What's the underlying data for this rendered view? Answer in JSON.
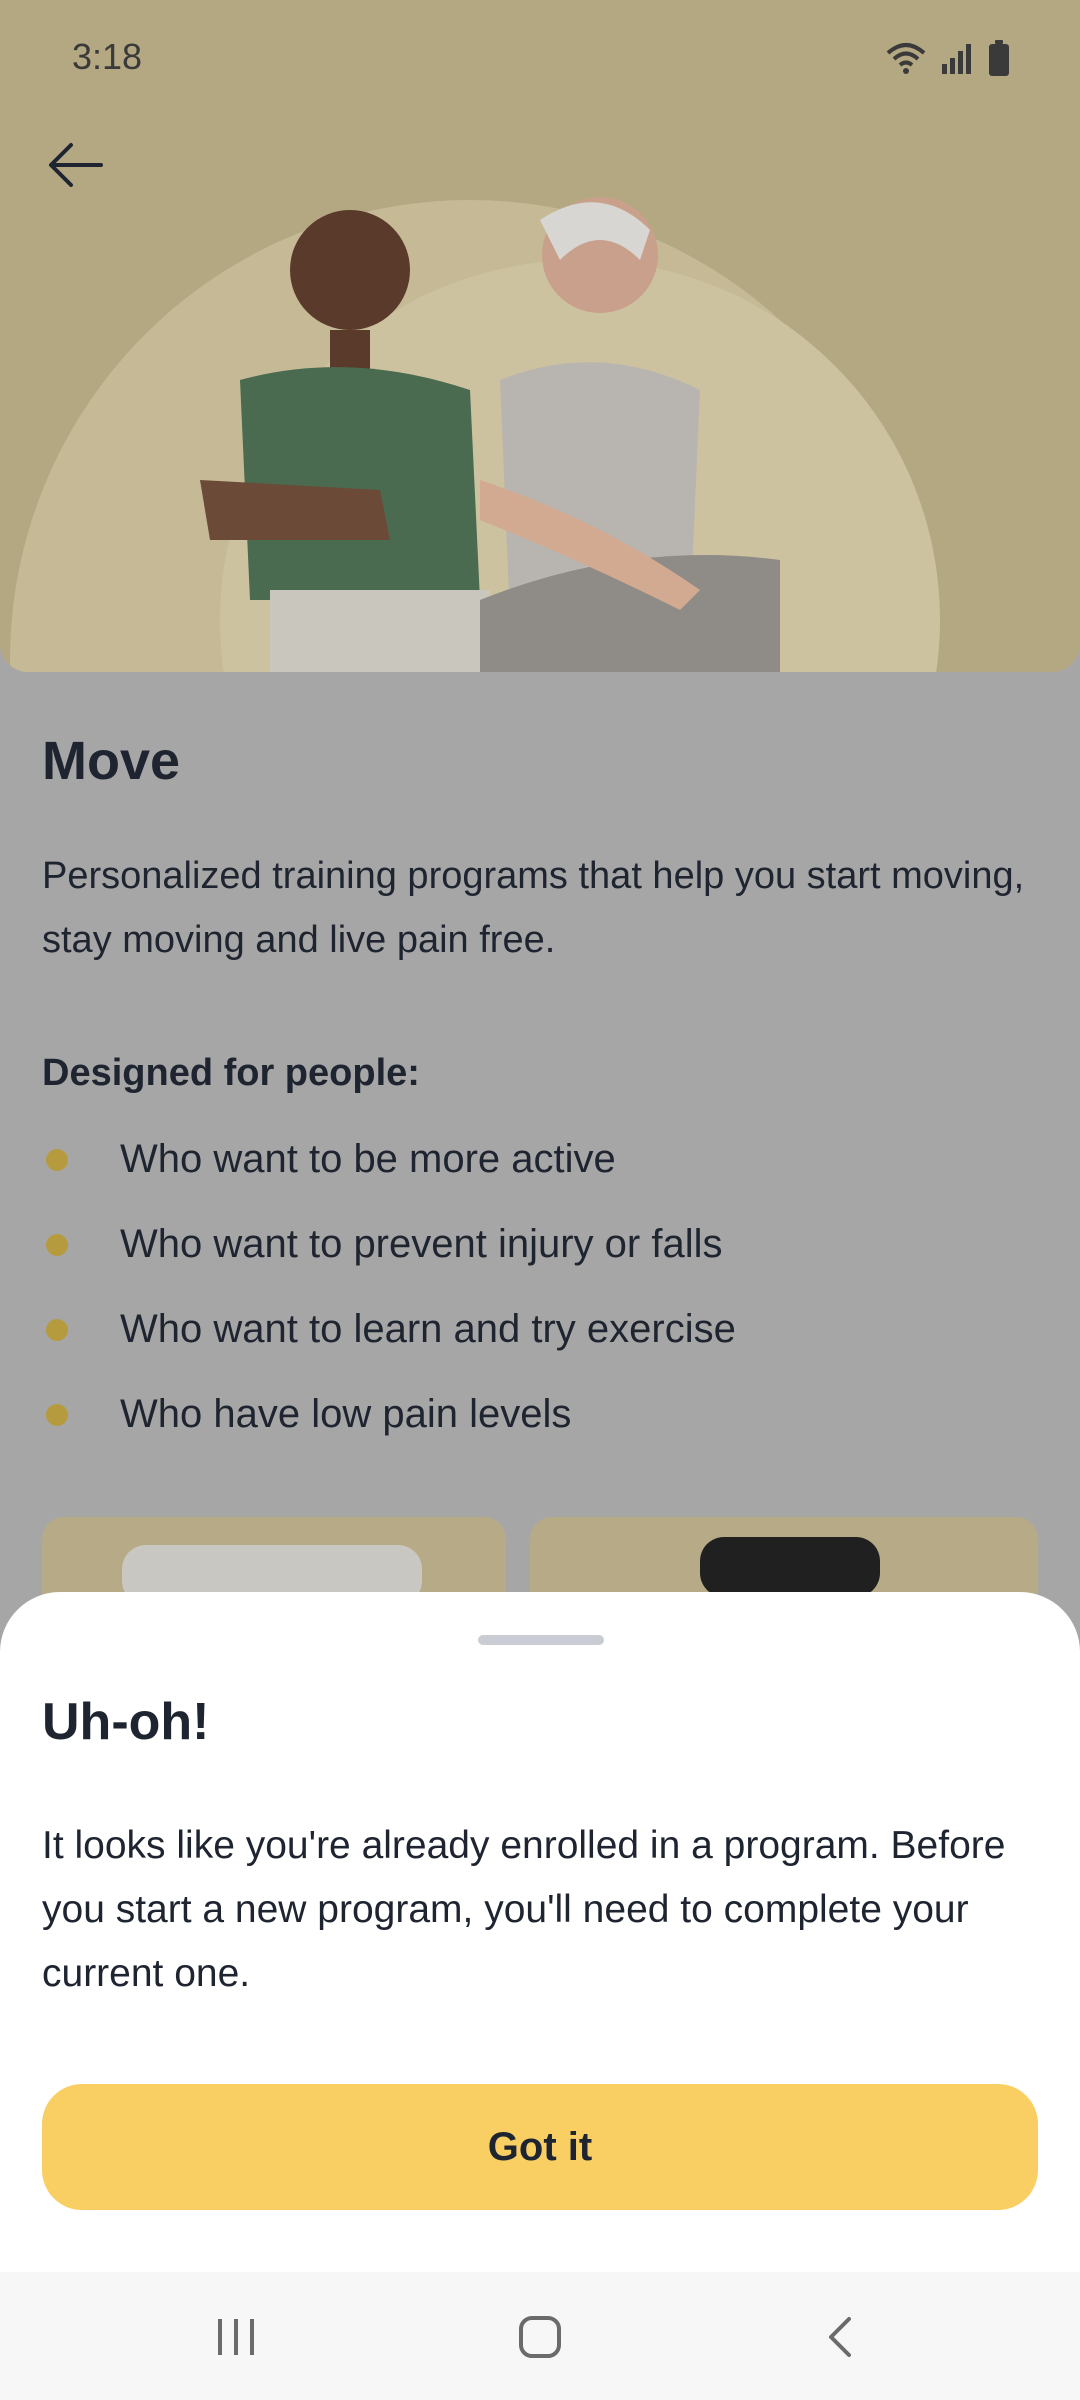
{
  "status_bar": {
    "time": "3:18"
  },
  "header": {
    "back_icon": "arrow-left-icon"
  },
  "program": {
    "title": "Move",
    "description": "Personalized training programs that help you start moving, stay moving and live pain free.",
    "designed_for_label": "Designed for people:",
    "bullets": [
      "Who want to be more active",
      "Who want to prevent injury or falls",
      "Who want to learn and try exercise",
      "Who have low pain levels"
    ]
  },
  "sheet": {
    "title": "Uh-oh!",
    "message": "It looks like you're already enrolled in a program. Before you start a new program, you'll need to complete your current one.",
    "button_label": "Got it"
  },
  "nav": {
    "recents_icon": "recents-icon",
    "home_icon": "home-icon",
    "back_icon": "back-chevron-icon"
  },
  "colors": {
    "accent": "#f9cf63",
    "bullet": "#b59b3d",
    "scrim": "#a6a6a6",
    "sheet": "#ffffff"
  }
}
